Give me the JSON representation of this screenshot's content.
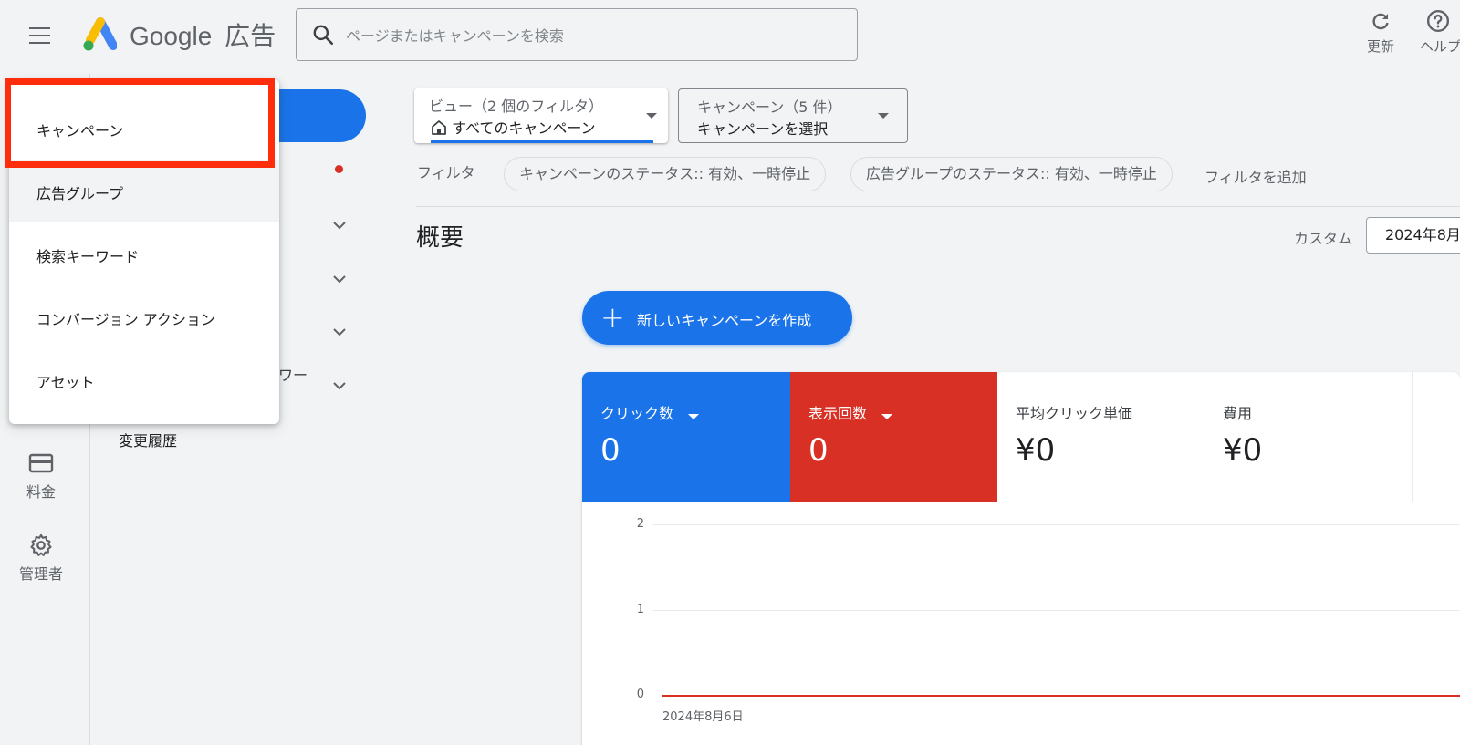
{
  "header": {
    "brand_google": "Google",
    "brand_product": "広告",
    "search_placeholder": "ページまたはキャンペーンを検索",
    "refresh_label": "更新",
    "help_label": "ヘルプ"
  },
  "rail": {
    "items": [
      {
        "label": "料金",
        "icon": "credit-card-icon"
      },
      {
        "label": "管理者",
        "icon": "gear-icon"
      }
    ]
  },
  "nav": {
    "partial_text": "ワー",
    "history": "変更履歴"
  },
  "dropdown": {
    "items": [
      {
        "label": "キャンペーン",
        "highlighted": true
      },
      {
        "label": "広告グループ",
        "hover": true
      },
      {
        "label": "検索キーワード"
      },
      {
        "label": "コンバージョン アクション"
      },
      {
        "label": "アセット"
      }
    ]
  },
  "view_selector": {
    "label": "ビュー（2 個のフィルタ）",
    "value": "すべてのキャンペーン"
  },
  "campaign_selector": {
    "label": "キャンペーン（5 件）",
    "value": "キャンペーンを選択"
  },
  "filters": {
    "label": "フィルタ",
    "chips": [
      "キャンペーンのステータス:: 有効、一時停止",
      "広告グループのステータス:: 有効、一時停止"
    ],
    "add": "フィルタを追加"
  },
  "overview": {
    "title": "概要",
    "range_label": "カスタム",
    "date": "2024年8月"
  },
  "new_campaign_button": "新しいキャンペーンを作成",
  "metrics": [
    {
      "label": "クリック数",
      "value": "0"
    },
    {
      "label": "表示回数",
      "value": "0"
    },
    {
      "label": "平均クリック単価",
      "value": "¥0"
    },
    {
      "label": "費用",
      "value": "¥0"
    }
  ],
  "colors": {
    "primary_blue": "#1a73e8",
    "red": "#d93025",
    "highlight_border": "#ff2d0c"
  },
  "chart_data": {
    "type": "line",
    "x": [
      "2024年8月6日"
    ],
    "series": [
      {
        "values": [
          0
        ],
        "color": "#d93025"
      }
    ],
    "yticks": [
      "2",
      "1",
      "0"
    ],
    "ylim": [
      0,
      2
    ],
    "xtick_labels": [
      "2024年8月6日"
    ],
    "grid": true
  }
}
